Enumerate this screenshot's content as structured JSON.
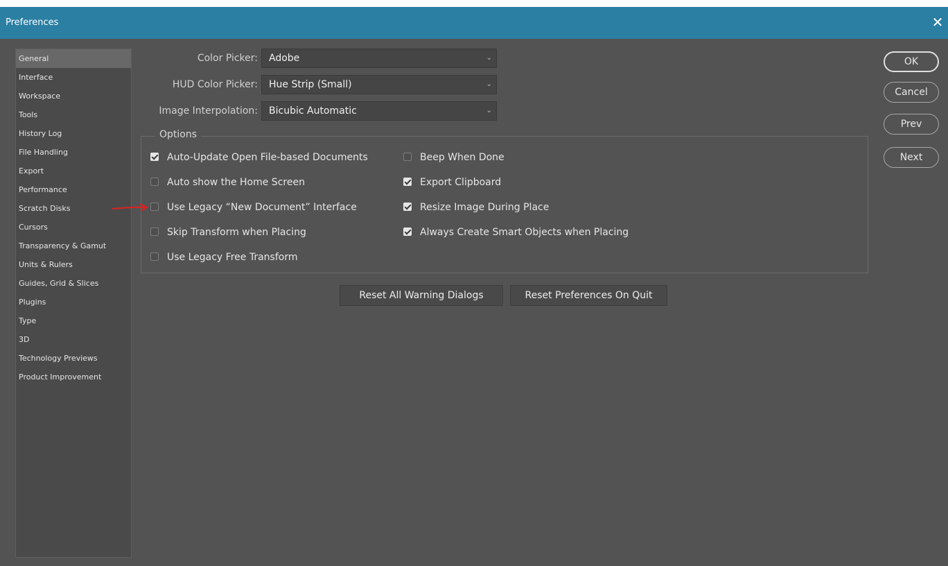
{
  "window": {
    "title": "Preferences",
    "close_glyph": "✕"
  },
  "sidebar": {
    "items": [
      {
        "label": "General",
        "selected": true
      },
      {
        "label": "Interface"
      },
      {
        "label": "Workspace"
      },
      {
        "label": "Tools"
      },
      {
        "label": "History Log"
      },
      {
        "label": "File Handling"
      },
      {
        "label": "Export"
      },
      {
        "label": "Performance"
      },
      {
        "label": "Scratch Disks"
      },
      {
        "label": "Cursors"
      },
      {
        "label": "Transparency & Gamut"
      },
      {
        "label": "Units & Rulers"
      },
      {
        "label": "Guides, Grid & Slices"
      },
      {
        "label": "Plugins"
      },
      {
        "label": "Type"
      },
      {
        "label": "3D"
      },
      {
        "label": "Technology Previews"
      },
      {
        "label": "Product Improvement"
      }
    ]
  },
  "fields": {
    "color_picker": {
      "label": "Color Picker:",
      "value": "Adobe"
    },
    "hud_color_picker": {
      "label": "HUD Color Picker:",
      "value": "Hue Strip (Small)"
    },
    "image_interpolation": {
      "label": "Image Interpolation:",
      "value": "Bicubic Automatic"
    }
  },
  "options": {
    "legend": "Options",
    "left": [
      {
        "label": "Auto-Update Open File-based Documents",
        "checked": true
      },
      {
        "label": "Auto show the Home Screen",
        "checked": false
      },
      {
        "label": "Use Legacy “New Document” Interface",
        "checked": false
      },
      {
        "label": "Skip Transform when Placing",
        "checked": false
      },
      {
        "label": "Use Legacy Free Transform",
        "checked": false
      }
    ],
    "right": [
      {
        "label": "Beep When Done",
        "checked": false
      },
      {
        "label": "Export Clipboard",
        "checked": true
      },
      {
        "label": "Resize Image During Place",
        "checked": true
      },
      {
        "label": "Always Create Smart Objects when Placing",
        "checked": true
      }
    ]
  },
  "buttons": {
    "reset_warnings": "Reset All Warning Dialogs",
    "reset_prefs": "Reset Preferences On Quit",
    "ok": "OK",
    "cancel": "Cancel",
    "prev": "Prev",
    "next": "Next"
  },
  "colors": {
    "titlebar": "#2b7fa3",
    "panel": "#535353",
    "annotation_arrow": "#e02020"
  }
}
